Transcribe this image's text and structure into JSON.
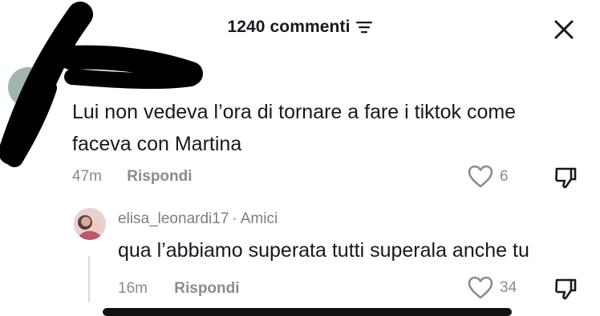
{
  "header": {
    "comments_count_label": "1240 commenti",
    "filter_icon": "filter-lines-icon",
    "close_icon": "close-icon"
  },
  "comment": {
    "text_line1": "Lui non vedeva l’ora di tornare a fare i tiktok come",
    "text_line2": "faceva con Martina",
    "time": "47m",
    "reply_label": "Rispondi",
    "likes": "6"
  },
  "reply": {
    "username": "elisa_leonardi17",
    "separator": "·",
    "relation": "Amici",
    "text": "qua l’abbiamo superata tutti superala anche tu",
    "time": "16m",
    "reply_label": "Rispondi",
    "likes": "34"
  },
  "colors": {
    "text_primary": "#161823",
    "text_secondary": "#8a8b91",
    "redaction": "#000000"
  }
}
